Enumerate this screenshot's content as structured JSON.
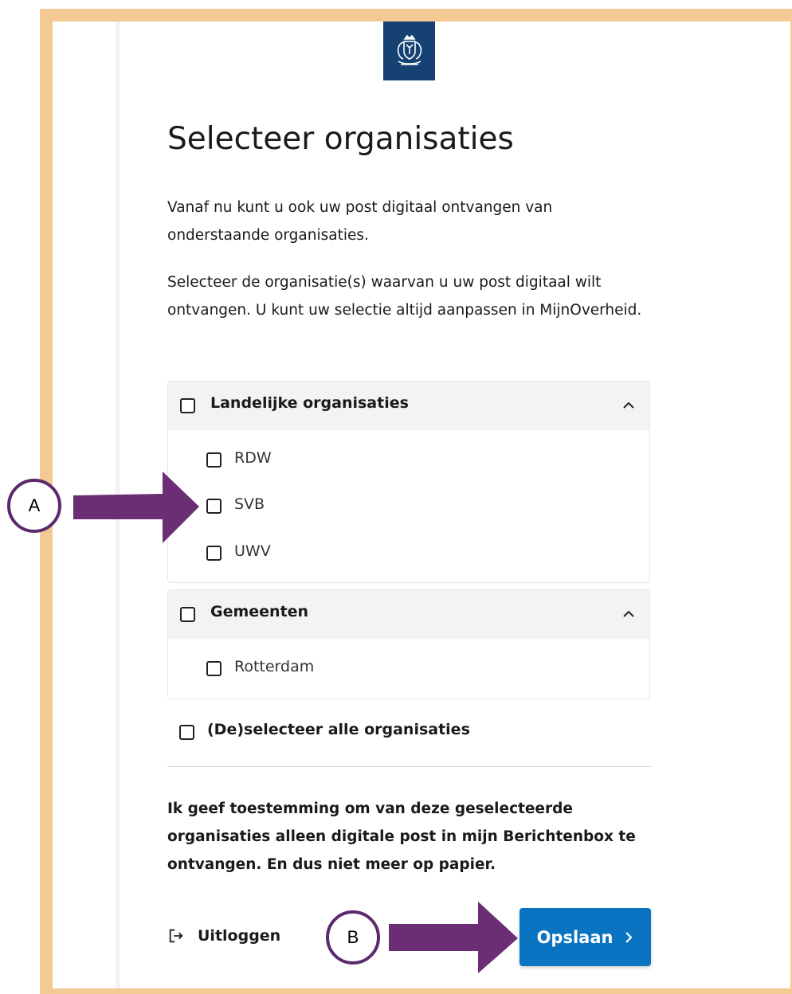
{
  "header": {
    "logo_icon": "rijksoverheid-crest-icon",
    "logo_color": "#154273"
  },
  "page": {
    "title": "Selecteer organisaties",
    "intro": "Vanaf nu kunt u ook uw post digitaal ontvangen van onderstaande organisaties.",
    "instruction": "Selecteer de organisatie(s) waarvan u uw post digitaal wilt ontvangen. U kunt uw selectie altijd aanpassen in MijnOverheid."
  },
  "groups": [
    {
      "label": "Landelijke organisaties",
      "expanded": true,
      "checked": false,
      "items": [
        {
          "label": "RDW",
          "checked": false
        },
        {
          "label": "SVB",
          "checked": false
        },
        {
          "label": "UWV",
          "checked": false
        }
      ]
    },
    {
      "label": "Gemeenten",
      "expanded": true,
      "checked": false,
      "items": [
        {
          "label": "Rotterdam",
          "checked": false
        }
      ]
    }
  ],
  "select_all": {
    "label": "(De)selecteer alle organisaties",
    "checked": false
  },
  "consent": "Ik geef toestemming om van deze geselecteerde organisaties alleen digitale post in mijn Berichtenbox te ontvangen. En dus niet meer op papier.",
  "footer": {
    "logout_label": "Uitloggen",
    "logout_icon": "logout-arrow-icon",
    "save_label": "Opslaan",
    "save_icon": "chevron-right-icon",
    "save_color": "#0a74c2"
  },
  "annotations": {
    "marker_a": "A",
    "marker_b": "B",
    "arrow_color": "#6b2d74",
    "frame_color": "#f5c994"
  }
}
